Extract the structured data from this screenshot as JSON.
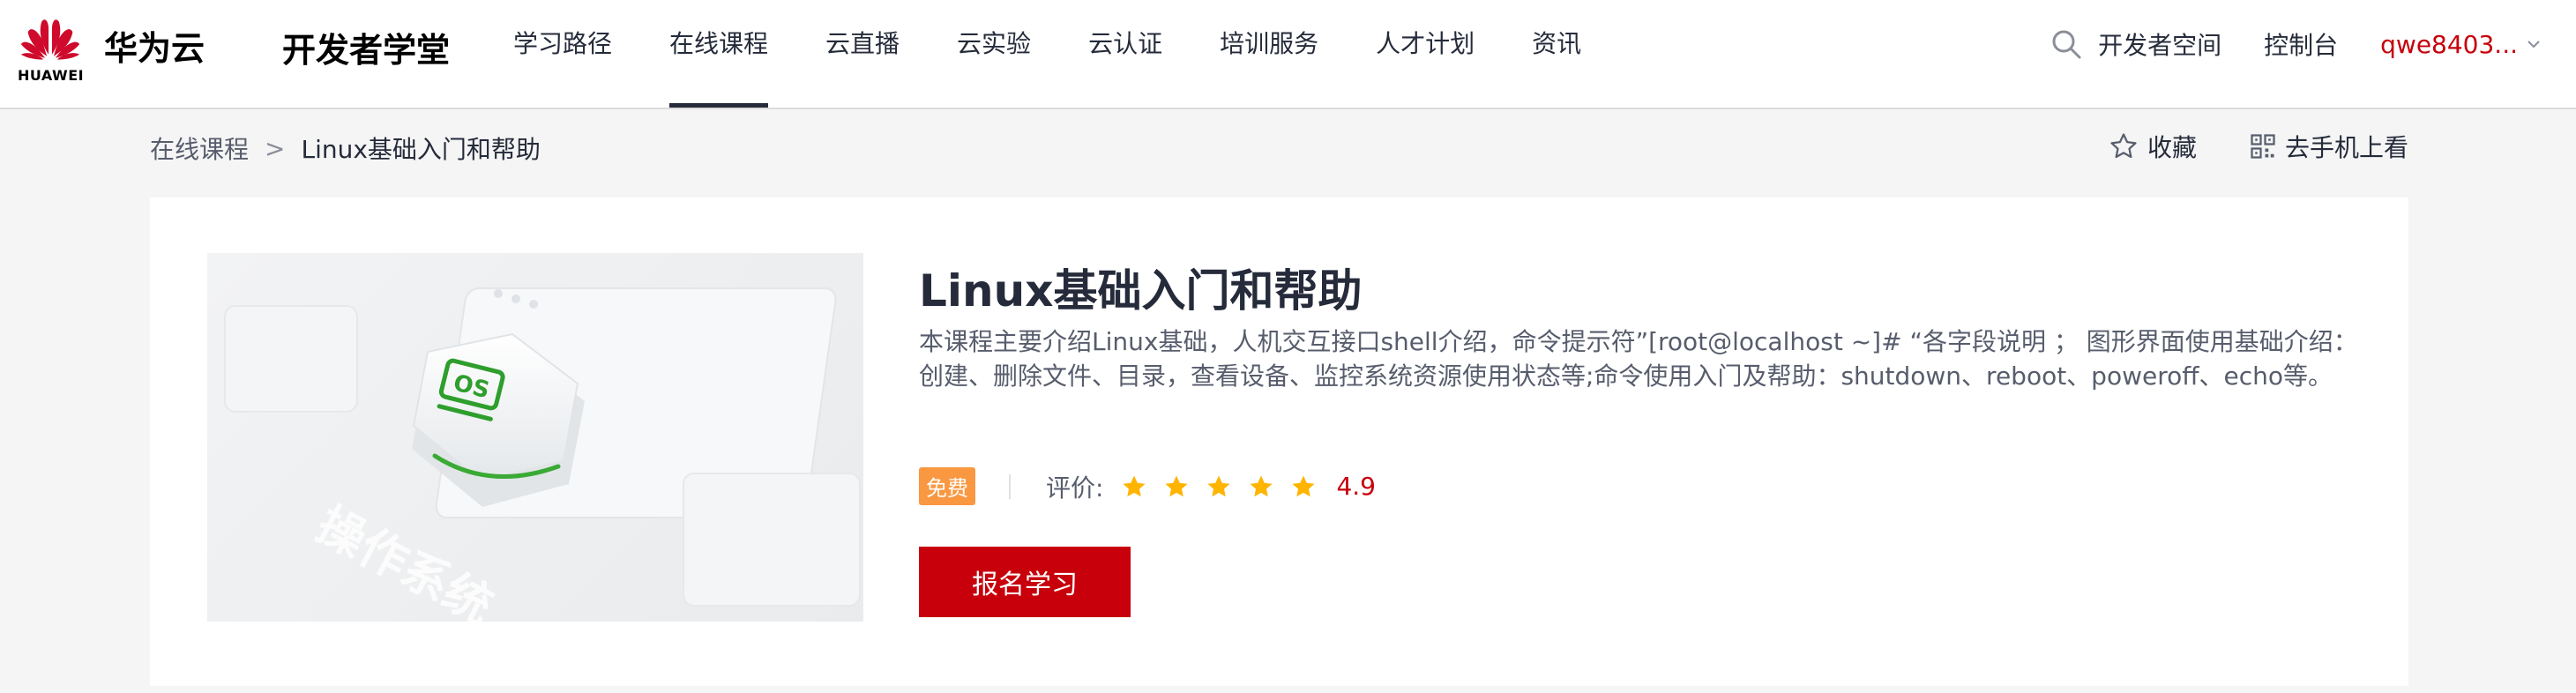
{
  "header": {
    "logo_text": "HUAWEI",
    "brand": "华为云",
    "product": "开发者学堂",
    "nav": [
      {
        "label": "学习路径",
        "active": false
      },
      {
        "label": "在线课程",
        "active": true
      },
      {
        "label": "云直播",
        "active": false
      },
      {
        "label": "云实验",
        "active": false
      },
      {
        "label": "云认证",
        "active": false
      },
      {
        "label": "培训服务",
        "active": false
      },
      {
        "label": "人才计划",
        "active": false
      },
      {
        "label": "资讯",
        "active": false
      }
    ],
    "developer_space": "开发者空间",
    "console": "控制台",
    "username": "qwe8403..."
  },
  "breadcrumb": {
    "parent": "在线课程",
    "separator": ">",
    "current": "Linux基础入门和帮助"
  },
  "actions": {
    "favorite": "收藏",
    "mobile": "去手机上看"
  },
  "course": {
    "cover_text": "操作系统",
    "cover_icon": "os-icon",
    "title": "Linux基础入门和帮助",
    "description": "本课程主要介绍Linux基础，人机交互接口shell介绍，命令提示符”[root@localhost ~]# “各字段说明 ； 图形界面使用基础介绍：创建、删除文件、目录，查看设备、监控系统资源使用状态等;命令使用入门及帮助：shutdown、reboot、poweroff、echo等。",
    "badge": "免费",
    "rating_label": "评价:",
    "rating_value": "4.9",
    "stars": 5,
    "enroll_label": "报名学习"
  },
  "colors": {
    "brand_red": "#c7000b",
    "badge_orange": "#fa9841",
    "star_yellow": "#ffb400"
  }
}
